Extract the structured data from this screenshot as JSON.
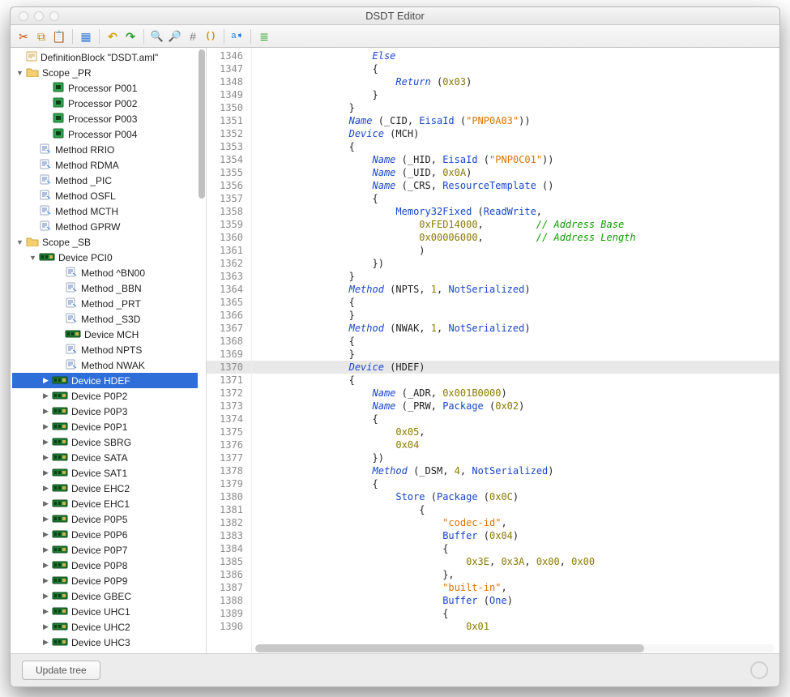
{
  "window": {
    "title": "DSDT Editor"
  },
  "toolbar": {
    "cut": "✂",
    "copy": "⧉",
    "paste": "📋",
    "clear": "▦",
    "undo": "↶",
    "redo": "↷",
    "zoom_in": "🔍",
    "zoom_out": "🔎",
    "hash": "#",
    "paren": "( )",
    "rename": "a➧",
    "format": "≣"
  },
  "tree": {
    "rows": [
      {
        "depth": 0,
        "disclosure": "",
        "icon": "block",
        "label": "DefinitionBlock \"DSDT.aml\""
      },
      {
        "depth": 0,
        "disclosure": "▼",
        "icon": "folder",
        "label": "Scope _PR"
      },
      {
        "depth": 2,
        "disclosure": "",
        "icon": "chip",
        "label": "Processor P001"
      },
      {
        "depth": 2,
        "disclosure": "",
        "icon": "chip",
        "label": "Processor P002"
      },
      {
        "depth": 2,
        "disclosure": "",
        "icon": "chip",
        "label": "Processor P003"
      },
      {
        "depth": 2,
        "disclosure": "",
        "icon": "chip",
        "label": "Processor P004"
      },
      {
        "depth": 1,
        "disclosure": "",
        "icon": "method",
        "label": "Method RRIO"
      },
      {
        "depth": 1,
        "disclosure": "",
        "icon": "method",
        "label": "Method RDMA"
      },
      {
        "depth": 1,
        "disclosure": "",
        "icon": "method",
        "label": "Method _PIC"
      },
      {
        "depth": 1,
        "disclosure": "",
        "icon": "method",
        "label": "Method OSFL"
      },
      {
        "depth": 1,
        "disclosure": "",
        "icon": "method",
        "label": "Method MCTH"
      },
      {
        "depth": 1,
        "disclosure": "",
        "icon": "method",
        "label": "Method GPRW"
      },
      {
        "depth": 0,
        "disclosure": "▼",
        "icon": "folder",
        "label": "Scope _SB"
      },
      {
        "depth": 1,
        "disclosure": "▼",
        "icon": "device",
        "label": "Device PCI0"
      },
      {
        "depth": 3,
        "disclosure": "",
        "icon": "method",
        "label": "Method ^BN00"
      },
      {
        "depth": 3,
        "disclosure": "",
        "icon": "method",
        "label": "Method _BBN"
      },
      {
        "depth": 3,
        "disclosure": "",
        "icon": "method",
        "label": "Method _PRT"
      },
      {
        "depth": 3,
        "disclosure": "",
        "icon": "method",
        "label": "Method _S3D"
      },
      {
        "depth": 3,
        "disclosure": "",
        "icon": "device",
        "label": "Device MCH"
      },
      {
        "depth": 3,
        "disclosure": "",
        "icon": "method",
        "label": "Method NPTS"
      },
      {
        "depth": 3,
        "disclosure": "",
        "icon": "method",
        "label": "Method NWAK"
      },
      {
        "depth": 2,
        "disclosure": "▶",
        "icon": "device",
        "label": "Device HDEF",
        "sel": true
      },
      {
        "depth": 2,
        "disclosure": "▶",
        "icon": "device",
        "label": "Device P0P2"
      },
      {
        "depth": 2,
        "disclosure": "▶",
        "icon": "device",
        "label": "Device P0P3"
      },
      {
        "depth": 2,
        "disclosure": "▶",
        "icon": "device",
        "label": "Device P0P1"
      },
      {
        "depth": 2,
        "disclosure": "▶",
        "icon": "device",
        "label": "Device SBRG"
      },
      {
        "depth": 2,
        "disclosure": "▶",
        "icon": "device",
        "label": "Device SATA"
      },
      {
        "depth": 2,
        "disclosure": "▶",
        "icon": "device",
        "label": "Device SAT1"
      },
      {
        "depth": 2,
        "disclosure": "▶",
        "icon": "device",
        "label": "Device EHC2"
      },
      {
        "depth": 2,
        "disclosure": "▶",
        "icon": "device",
        "label": "Device EHC1"
      },
      {
        "depth": 2,
        "disclosure": "▶",
        "icon": "device",
        "label": "Device P0P5"
      },
      {
        "depth": 2,
        "disclosure": "▶",
        "icon": "device",
        "label": "Device P0P6"
      },
      {
        "depth": 2,
        "disclosure": "▶",
        "icon": "device",
        "label": "Device P0P7"
      },
      {
        "depth": 2,
        "disclosure": "▶",
        "icon": "device",
        "label": "Device P0P8"
      },
      {
        "depth": 2,
        "disclosure": "▶",
        "icon": "device",
        "label": "Device P0P9"
      },
      {
        "depth": 2,
        "disclosure": "▶",
        "icon": "device",
        "label": "Device GBEC"
      },
      {
        "depth": 2,
        "disclosure": "▶",
        "icon": "device",
        "label": "Device UHC1"
      },
      {
        "depth": 2,
        "disclosure": "▶",
        "icon": "device",
        "label": "Device UHC2"
      },
      {
        "depth": 2,
        "disclosure": "▶",
        "icon": "device",
        "label": "Device UHC3"
      }
    ]
  },
  "editor": {
    "first_line": 1346,
    "highlight_line": 1370,
    "lines": [
      {
        "segs": [
          {
            "t": "                    ",
            "c": ""
          },
          {
            "t": "Else",
            "c": "kw"
          }
        ]
      },
      {
        "segs": [
          {
            "t": "                    {",
            "c": ""
          }
        ]
      },
      {
        "segs": [
          {
            "t": "                        ",
            "c": ""
          },
          {
            "t": "Return",
            "c": "kw"
          },
          {
            "t": " (",
            "c": ""
          },
          {
            "t": "0x03",
            "c": "num"
          },
          {
            "t": ")",
            "c": ""
          }
        ]
      },
      {
        "segs": [
          {
            "t": "                    }",
            "c": ""
          }
        ]
      },
      {
        "segs": [
          {
            "t": "                }",
            "c": ""
          }
        ]
      },
      {
        "segs": [
          {
            "t": "                ",
            "c": ""
          },
          {
            "t": "Name",
            "c": "kw"
          },
          {
            "t": " (_CID, ",
            "c": ""
          },
          {
            "t": "EisaId",
            "c": "id2"
          },
          {
            "t": " (",
            "c": ""
          },
          {
            "t": "\"PNP0A03\"",
            "c": "str"
          },
          {
            "t": "))",
            "c": ""
          }
        ]
      },
      {
        "segs": [
          {
            "t": "                ",
            "c": ""
          },
          {
            "t": "Device",
            "c": "kw"
          },
          {
            "t": " (MCH)",
            "c": ""
          }
        ]
      },
      {
        "segs": [
          {
            "t": "                {",
            "c": ""
          }
        ]
      },
      {
        "segs": [
          {
            "t": "                    ",
            "c": ""
          },
          {
            "t": "Name",
            "c": "kw"
          },
          {
            "t": " (_HID, ",
            "c": ""
          },
          {
            "t": "EisaId",
            "c": "id2"
          },
          {
            "t": " (",
            "c": ""
          },
          {
            "t": "\"PNP0C01\"",
            "c": "str"
          },
          {
            "t": "))",
            "c": ""
          }
        ]
      },
      {
        "segs": [
          {
            "t": "                    ",
            "c": ""
          },
          {
            "t": "Name",
            "c": "kw"
          },
          {
            "t": " (_UID, ",
            "c": ""
          },
          {
            "t": "0x0A",
            "c": "num"
          },
          {
            "t": ")",
            "c": ""
          }
        ]
      },
      {
        "segs": [
          {
            "t": "                    ",
            "c": ""
          },
          {
            "t": "Name",
            "c": "kw"
          },
          {
            "t": " (_CRS, ",
            "c": ""
          },
          {
            "t": "ResourceTemplate",
            "c": "id2"
          },
          {
            "t": " ()",
            "c": ""
          }
        ]
      },
      {
        "segs": [
          {
            "t": "                    {",
            "c": ""
          }
        ]
      },
      {
        "segs": [
          {
            "t": "                        ",
            "c": ""
          },
          {
            "t": "Memory32Fixed",
            "c": "id2"
          },
          {
            "t": " (",
            "c": ""
          },
          {
            "t": "ReadWrite",
            "c": "id2"
          },
          {
            "t": ",",
            "c": ""
          }
        ]
      },
      {
        "segs": [
          {
            "t": "                            ",
            "c": ""
          },
          {
            "t": "0xFED14000",
            "c": "num"
          },
          {
            "t": ",         ",
            "c": ""
          },
          {
            "t": "// Address Base",
            "c": "cmt"
          }
        ]
      },
      {
        "segs": [
          {
            "t": "                            ",
            "c": ""
          },
          {
            "t": "0x00006000",
            "c": "num"
          },
          {
            "t": ",         ",
            "c": ""
          },
          {
            "t": "// Address Length",
            "c": "cmt"
          }
        ]
      },
      {
        "segs": [
          {
            "t": "                            )",
            "c": ""
          }
        ]
      },
      {
        "segs": [
          {
            "t": "                    })",
            "c": ""
          }
        ]
      },
      {
        "segs": [
          {
            "t": "                }",
            "c": ""
          }
        ]
      },
      {
        "segs": [
          {
            "t": "                ",
            "c": ""
          },
          {
            "t": "Method",
            "c": "kw"
          },
          {
            "t": " (NPTS, ",
            "c": ""
          },
          {
            "t": "1",
            "c": "num"
          },
          {
            "t": ", ",
            "c": ""
          },
          {
            "t": "NotSerialized",
            "c": "id2"
          },
          {
            "t": ")",
            "c": ""
          }
        ]
      },
      {
        "segs": [
          {
            "t": "                {",
            "c": ""
          }
        ]
      },
      {
        "segs": [
          {
            "t": "                }",
            "c": ""
          }
        ]
      },
      {
        "segs": [
          {
            "t": "                ",
            "c": ""
          },
          {
            "t": "Method",
            "c": "kw"
          },
          {
            "t": " (NWAK, ",
            "c": ""
          },
          {
            "t": "1",
            "c": "num"
          },
          {
            "t": ", ",
            "c": ""
          },
          {
            "t": "NotSerialized",
            "c": "id2"
          },
          {
            "t": ")",
            "c": ""
          }
        ]
      },
      {
        "segs": [
          {
            "t": "                {",
            "c": ""
          }
        ]
      },
      {
        "segs": [
          {
            "t": "                }",
            "c": ""
          }
        ]
      },
      {
        "segs": [
          {
            "t": "                ",
            "c": ""
          },
          {
            "t": "Device",
            "c": "kw"
          },
          {
            "t": " (HDEF)",
            "c": ""
          }
        ]
      },
      {
        "segs": [
          {
            "t": "                {",
            "c": ""
          }
        ]
      },
      {
        "segs": [
          {
            "t": "                    ",
            "c": ""
          },
          {
            "t": "Name",
            "c": "kw"
          },
          {
            "t": " (_ADR, ",
            "c": ""
          },
          {
            "t": "0x001B0000",
            "c": "num"
          },
          {
            "t": ")",
            "c": ""
          }
        ]
      },
      {
        "segs": [
          {
            "t": "                    ",
            "c": ""
          },
          {
            "t": "Name",
            "c": "kw"
          },
          {
            "t": " (_PRW, ",
            "c": ""
          },
          {
            "t": "Package",
            "c": "id2"
          },
          {
            "t": " (",
            "c": ""
          },
          {
            "t": "0x02",
            "c": "num"
          },
          {
            "t": ")",
            "c": ""
          }
        ]
      },
      {
        "segs": [
          {
            "t": "                    {",
            "c": ""
          }
        ]
      },
      {
        "segs": [
          {
            "t": "                        ",
            "c": ""
          },
          {
            "t": "0x05",
            "c": "num"
          },
          {
            "t": ",",
            "c": ""
          }
        ]
      },
      {
        "segs": [
          {
            "t": "                        ",
            "c": ""
          },
          {
            "t": "0x04",
            "c": "num"
          }
        ]
      },
      {
        "segs": [
          {
            "t": "                    })",
            "c": ""
          }
        ]
      },
      {
        "segs": [
          {
            "t": "                    ",
            "c": ""
          },
          {
            "t": "Method",
            "c": "kw"
          },
          {
            "t": " (_DSM, ",
            "c": ""
          },
          {
            "t": "4",
            "c": "num"
          },
          {
            "t": ", ",
            "c": ""
          },
          {
            "t": "NotSerialized",
            "c": "id2"
          },
          {
            "t": ")",
            "c": ""
          }
        ]
      },
      {
        "segs": [
          {
            "t": "                    {",
            "c": ""
          }
        ]
      },
      {
        "segs": [
          {
            "t": "                        ",
            "c": ""
          },
          {
            "t": "Store",
            "c": "id2"
          },
          {
            "t": " (",
            "c": ""
          },
          {
            "t": "Package",
            "c": "id2"
          },
          {
            "t": " (",
            "c": ""
          },
          {
            "t": "0x0C",
            "c": "num"
          },
          {
            "t": ")",
            "c": ""
          }
        ]
      },
      {
        "segs": [
          {
            "t": "                            {",
            "c": ""
          }
        ]
      },
      {
        "segs": [
          {
            "t": "                                ",
            "c": ""
          },
          {
            "t": "\"codec-id\"",
            "c": "str"
          },
          {
            "t": ",",
            "c": ""
          }
        ]
      },
      {
        "segs": [
          {
            "t": "                                ",
            "c": ""
          },
          {
            "t": "Buffer",
            "c": "id2"
          },
          {
            "t": " (",
            "c": ""
          },
          {
            "t": "0x04",
            "c": "num"
          },
          {
            "t": ")",
            "c": ""
          }
        ]
      },
      {
        "segs": [
          {
            "t": "                                {",
            "c": ""
          }
        ]
      },
      {
        "segs": [
          {
            "t": "                                    ",
            "c": ""
          },
          {
            "t": "0x3E",
            "c": "num"
          },
          {
            "t": ", ",
            "c": ""
          },
          {
            "t": "0x3A",
            "c": "num"
          },
          {
            "t": ", ",
            "c": ""
          },
          {
            "t": "0x00",
            "c": "num"
          },
          {
            "t": ", ",
            "c": ""
          },
          {
            "t": "0x00",
            "c": "num"
          }
        ]
      },
      {
        "segs": [
          {
            "t": "                                },",
            "c": ""
          }
        ]
      },
      {
        "segs": [
          {
            "t": "                                ",
            "c": ""
          },
          {
            "t": "\"built-in\"",
            "c": "str"
          },
          {
            "t": ",",
            "c": ""
          }
        ]
      },
      {
        "segs": [
          {
            "t": "                                ",
            "c": ""
          },
          {
            "t": "Buffer",
            "c": "id2"
          },
          {
            "t": " (",
            "c": ""
          },
          {
            "t": "One",
            "c": "id2"
          },
          {
            "t": ")",
            "c": ""
          }
        ]
      },
      {
        "segs": [
          {
            "t": "                                {",
            "c": ""
          }
        ]
      },
      {
        "segs": [
          {
            "t": "                                    ",
            "c": ""
          },
          {
            "t": "0x01",
            "c": "num"
          }
        ]
      }
    ]
  },
  "footer": {
    "update_tree": "Update tree"
  }
}
